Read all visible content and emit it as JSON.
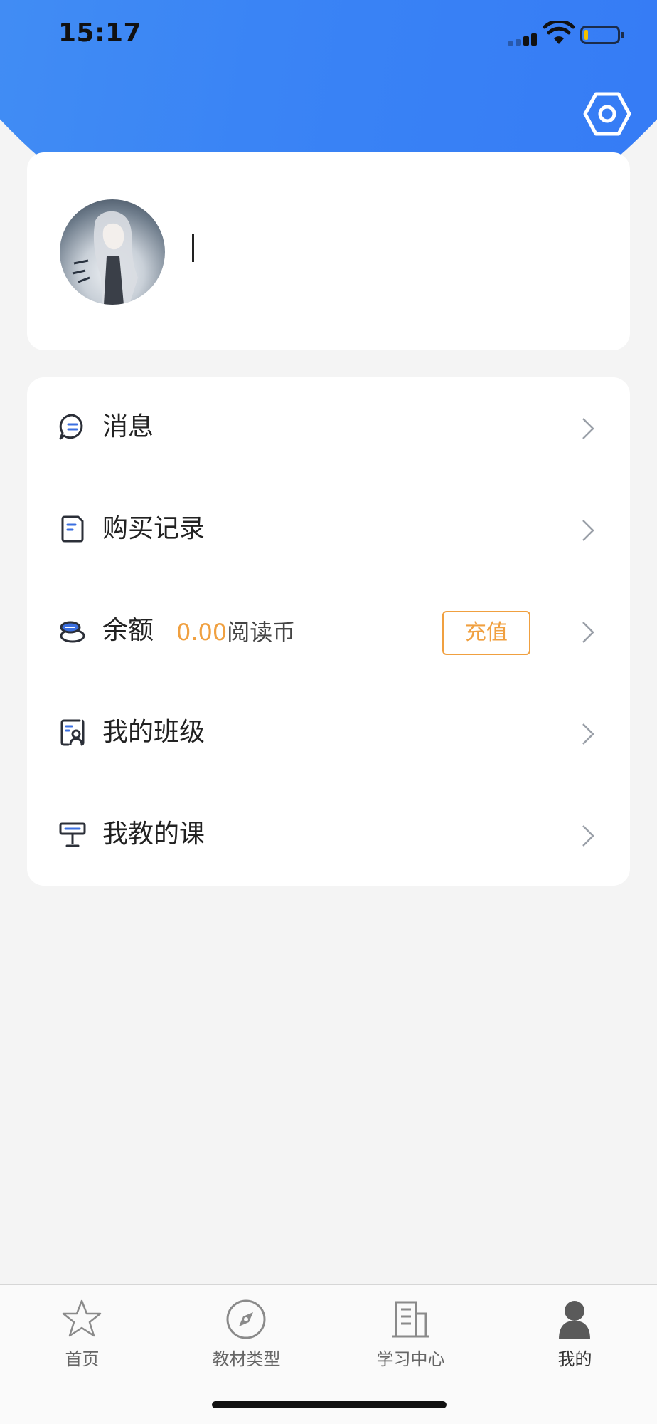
{
  "status_bar": {
    "time": "15:17"
  },
  "profile": {
    "username": ""
  },
  "menu": {
    "items": [
      {
        "key": "messages",
        "label": "消息",
        "icon": "message-bubble-icon"
      },
      {
        "key": "purchases",
        "label": "购买记录",
        "icon": "receipt-icon"
      },
      {
        "key": "balance",
        "label": "余额",
        "icon": "coins-icon",
        "amount": "0.00",
        "unit": "阅读币",
        "action_label": "充值"
      },
      {
        "key": "my-class",
        "label": "我的班级",
        "icon": "class-roster-icon"
      },
      {
        "key": "my-courses",
        "label": "我教的课",
        "icon": "lectern-icon"
      }
    ]
  },
  "tab_bar": {
    "tabs": [
      {
        "label": "首页",
        "icon": "star-icon",
        "active": false
      },
      {
        "label": "教材类型",
        "icon": "compass-icon",
        "active": false
      },
      {
        "label": "学习中心",
        "icon": "building-icon",
        "active": false
      },
      {
        "label": "我的",
        "icon": "person-icon",
        "active": true
      }
    ]
  },
  "colors": {
    "header_blue": "#3a84f5",
    "accent_orange": "#f0a040",
    "icon_blue": "#3b6fe0"
  }
}
